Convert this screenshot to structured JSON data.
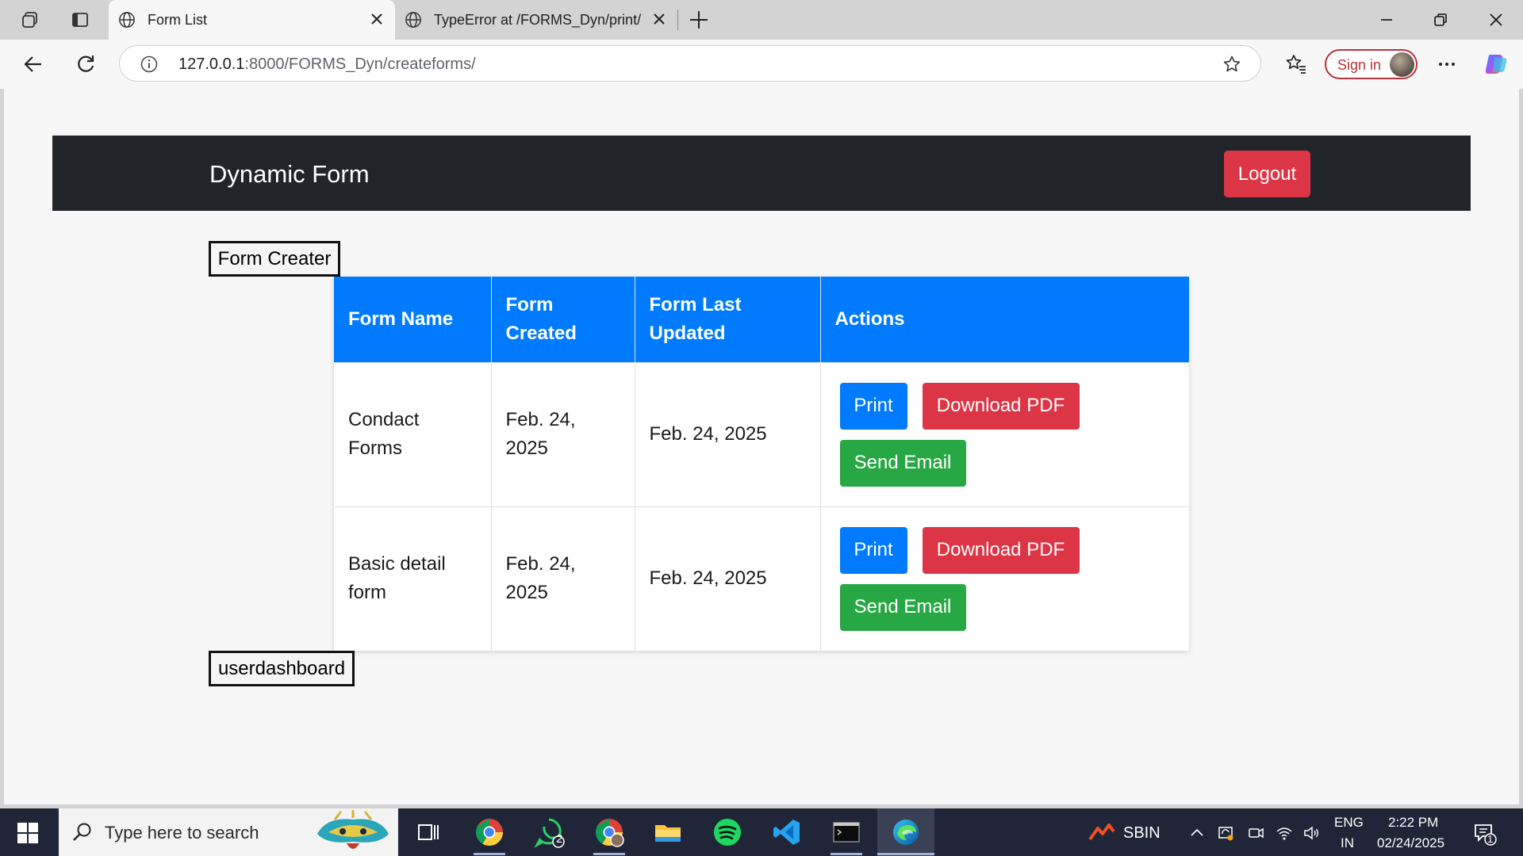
{
  "browser": {
    "tabs": [
      {
        "title": "Form List",
        "active": true
      },
      {
        "title": "TypeError at /FORMS_Dyn/print/",
        "active": false
      }
    ],
    "url_host": "127.0.0.1",
    "url_path": ":8000/FORMS_Dyn/createforms/",
    "sign_in_label": "Sign in"
  },
  "page": {
    "brand": "Dynamic Form",
    "logout_label": "Logout",
    "form_creater_label": "Form Creater",
    "userdashboard_label": "userdashboard",
    "table": {
      "headers": [
        "Form Name",
        "Form Created",
        "Form Last Updated",
        "Actions"
      ],
      "rows": [
        {
          "name": "Condact Forms",
          "created": "Feb. 24, 2025",
          "updated": "Feb. 24, 2025"
        },
        {
          "name": "Basic detail form",
          "created": "Feb. 24, 2025",
          "updated": "Feb. 24, 2025"
        }
      ],
      "action_labels": {
        "print": "Print",
        "pdf": "Download PDF",
        "email": "Send Email"
      }
    },
    "colors": {
      "nav_bg": "#212529",
      "header_bg": "#007bff",
      "danger": "#dc3545",
      "success": "#28a745",
      "primary": "#007bff"
    }
  },
  "taskbar": {
    "search_placeholder": "Type here to search",
    "whatsapp_badge": "2",
    "stock_label": "SBIN",
    "lang_top": "ENG",
    "lang_bottom": "IN",
    "time": "2:22 PM",
    "date": "02/24/2025",
    "notification_count": "1",
    "apps": [
      "task-view-icon",
      "chrome-icon",
      "whatsapp-icon",
      "chrome-profile-icon",
      "file-explorer-icon",
      "spotify-icon",
      "vscode-icon",
      "terminal-icon",
      "edge-icon"
    ]
  }
}
